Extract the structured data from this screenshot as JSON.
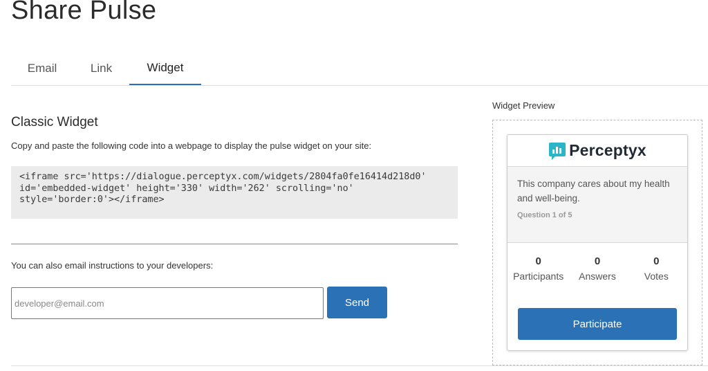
{
  "page": {
    "title": "Share Pulse"
  },
  "tabs": [
    {
      "label": "Email"
    },
    {
      "label": "Link"
    },
    {
      "label": "Widget",
      "active": true
    }
  ],
  "classic_widget": {
    "title": "Classic Widget",
    "instructions": "Copy and paste the following code into a webpage to display the pulse widget on your site:",
    "code_lines": [
      "<iframe src='https://dialogue.perceptyx.com/widgets/2804fa0fe16414d218d0'",
      "id='embedded-widget' height='330' width='262' scrolling='no'",
      "style='border:0'></iframe>"
    ]
  },
  "email_instructions": {
    "note": "You can also email instructions to your developers:",
    "input_value": "",
    "input_placeholder": "developer@email.com",
    "send_label": "Send"
  },
  "preview": {
    "label": "Widget Preview",
    "brand_name": "Perceptyx",
    "question": "This company cares about my health and well-being.",
    "question_counter": "Question 1 of 5",
    "stats": [
      {
        "value": "0",
        "label": "Participants"
      },
      {
        "value": "0",
        "label": "Answers"
      },
      {
        "value": "0",
        "label": "Votes"
      }
    ],
    "participate_label": "Participate"
  },
  "colors": {
    "accent": "#2a72b5",
    "logo_teal": "#2bb5c8",
    "code_background": "#ebebeb"
  },
  "icons": [
    "perceptyx-logo-icon"
  ]
}
